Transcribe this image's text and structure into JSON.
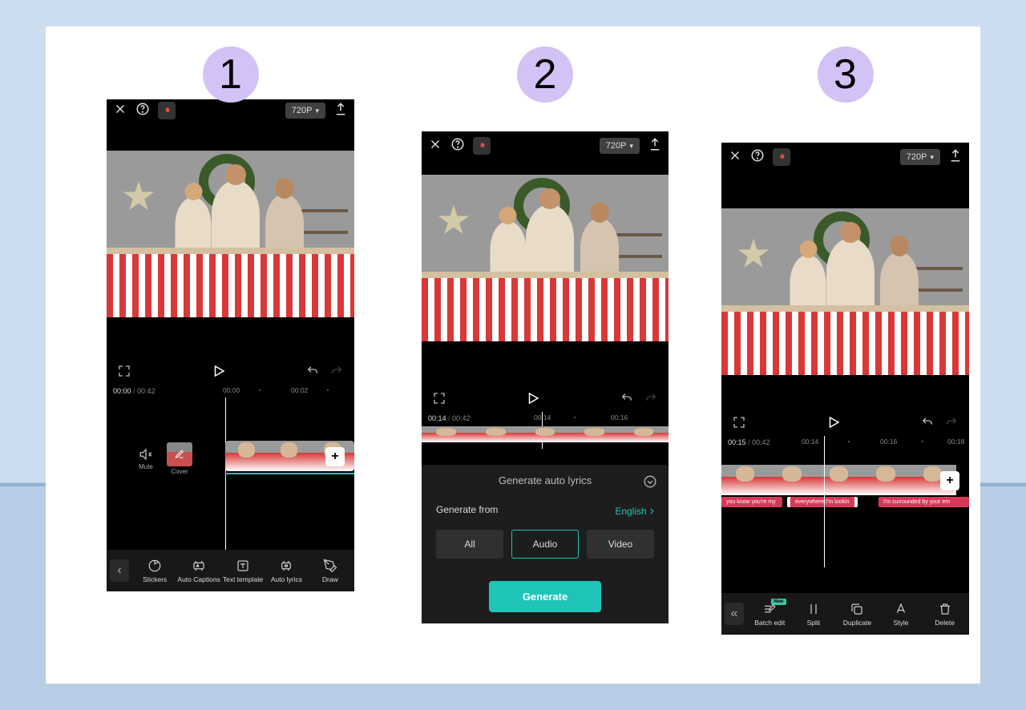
{
  "steps": [
    "1",
    "2",
    "3"
  ],
  "colors": {
    "accent": "#1fc4b8",
    "badge": "#d3c2f5",
    "lyric": "#d83858"
  },
  "common": {
    "resolution": "720P",
    "close": "✕",
    "mute": "Mute",
    "cover": "Cover",
    "plus": "+"
  },
  "phone1": {
    "time": {
      "current": "00:00",
      "total": "00:42"
    },
    "ticks": [
      "00:00",
      "00:02"
    ],
    "toolbar": [
      "Stickers",
      "Auto Captions",
      "Text template",
      "Auto lyrics",
      "Draw"
    ]
  },
  "phone2": {
    "time": {
      "current": "00:14",
      "total": "00:42"
    },
    "ticks": [
      "00:14",
      "00:16"
    ],
    "sheet": {
      "title": "Generate auto lyrics",
      "from_label": "Generate from",
      "language": "English",
      "options": [
        "All",
        "Audio",
        "Video"
      ],
      "selected": "Audio",
      "button": "Generate"
    }
  },
  "phone3": {
    "time": {
      "current": "00:15",
      "total": "00:42"
    },
    "ticks": [
      "00:14",
      "00:16",
      "00:18"
    ],
    "lyrics": [
      "you know you're my",
      "everywhere I'm lookin",
      "I'm surrounded by your em"
    ],
    "toolbar": [
      {
        "label": "Batch edit",
        "new": true
      },
      {
        "label": "Split",
        "new": false
      },
      {
        "label": "Duplicate",
        "new": false
      },
      {
        "label": "Style",
        "new": false
      },
      {
        "label": "Delete",
        "new": false
      }
    ]
  }
}
